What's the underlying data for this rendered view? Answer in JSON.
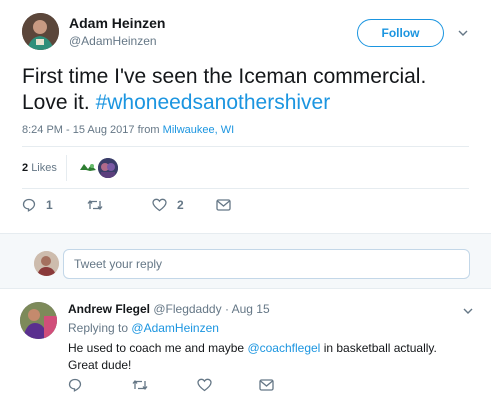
{
  "tweet": {
    "author_name": "Adam Heinzen",
    "author_handle": "@AdamHeinzen",
    "follow_label": "Follow",
    "text_main": "First time I've seen the Iceman commercial. Love it.",
    "hashtag": "#whoneedsanothershiver",
    "time": "8:24 PM - 15 Aug 2017 from",
    "location": "Milwaukee, WI",
    "likes_count": "2",
    "likes_label": "Likes",
    "reply_count": "1",
    "like_action_count": "2"
  },
  "reply_box": {
    "placeholder": "Tweet your reply"
  },
  "reply": {
    "author_name": "Andrew Flegel",
    "author_handle": "@Flegdaddy",
    "separator": "·",
    "date": "Aug 15",
    "replying_prefix": "Replying to",
    "replying_to": "@AdamHeinzen",
    "text_before": "He used to coach me and maybe",
    "mention": "@coachflegel",
    "text_after": "in basketball actually. Great dude!"
  },
  "colors": {
    "accent": "#1b95e0",
    "muted": "#657786",
    "divider": "#e6ecf0",
    "panel_bg": "#f5f8fa"
  }
}
